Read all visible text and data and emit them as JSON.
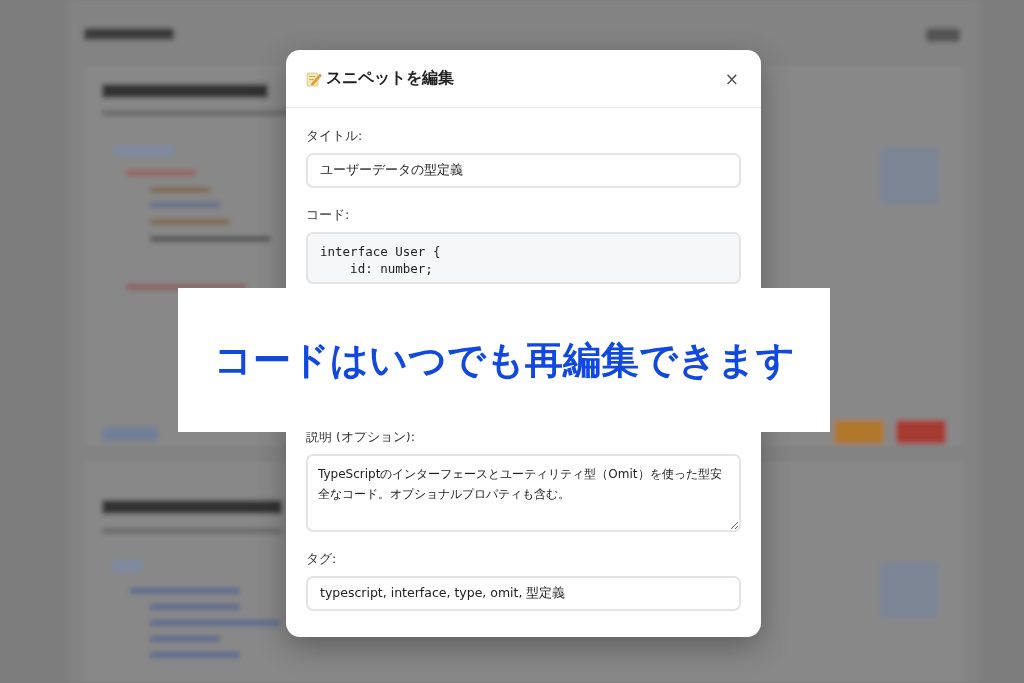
{
  "modal": {
    "title": "スニペットを編集",
    "close": "×",
    "fields": [
      {
        "kind": "input",
        "label": "タイトル:",
        "value": "ユーザーデータの型定義"
      },
      {
        "kind": "code",
        "label": "コード:",
        "value": "interface User {\n    id: number;"
      },
      {
        "kind": "textarea",
        "label": "説明 (オプション):",
        "value": "TypeScriptのインターフェースとユーティリティ型（Omit）を使った型安全なコード。オプショナルプロパティも含む。"
      },
      {
        "kind": "input",
        "label": "タグ:",
        "value": "typescript, interface, type, omit, 型定義"
      }
    ]
  },
  "banner": {
    "text": "コードはいつでも再編集できます"
  }
}
